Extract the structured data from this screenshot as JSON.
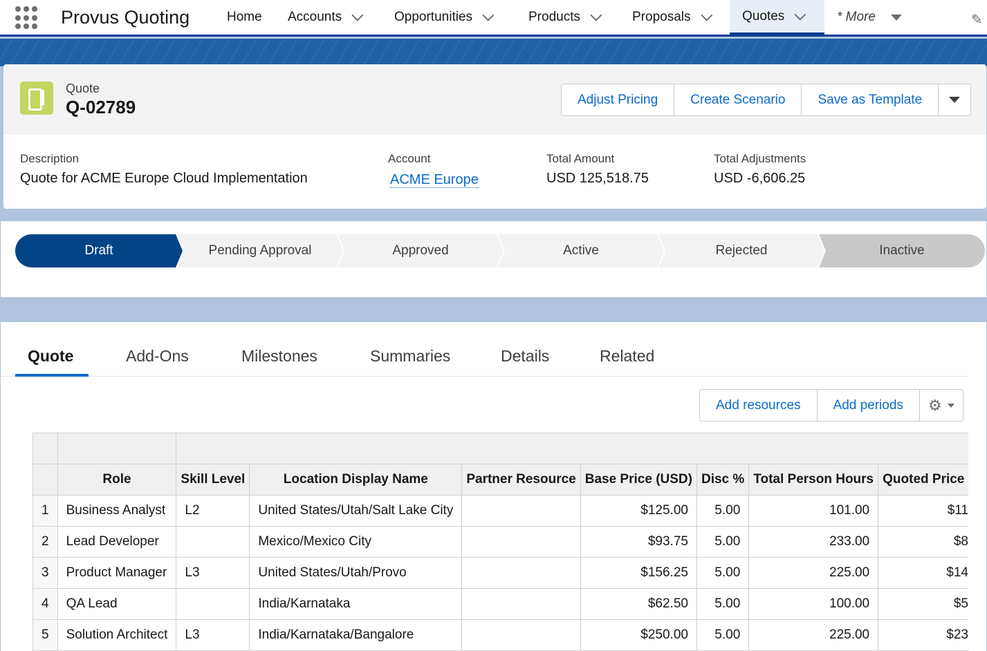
{
  "nav": {
    "app_name": "Provus Quoting",
    "items": [
      {
        "label": "Home",
        "dropdown": false
      },
      {
        "label": "Accounts",
        "dropdown": true
      },
      {
        "label": "Opportunities",
        "dropdown": true
      },
      {
        "label": "Products",
        "dropdown": true
      },
      {
        "label": "Proposals",
        "dropdown": true
      },
      {
        "label": "Quotes",
        "dropdown": true,
        "active": true
      }
    ],
    "more_label": "* More"
  },
  "header": {
    "object_label": "Quote",
    "record_name": "Q-02789",
    "actions": [
      "Adjust Pricing",
      "Create Scenario",
      "Save as Template"
    ]
  },
  "fields": [
    {
      "label": "Description",
      "value": "Quote for ACME Europe Cloud Implementation"
    },
    {
      "label": "Account",
      "value": "ACME Europe",
      "link": true
    },
    {
      "label": "Total Amount",
      "value": "USD 125,518.75"
    },
    {
      "label": "Total Adjustments",
      "value": "USD -6,606.25"
    }
  ],
  "path": {
    "stages": [
      "Draft",
      "Pending Approval",
      "Approved",
      "Active",
      "Rejected",
      "Inactive"
    ],
    "current": "Draft"
  },
  "tabs": [
    "Quote",
    "Add-Ons",
    "Milestones",
    "Summaries",
    "Details",
    "Related"
  ],
  "active_tab": "Quote",
  "grid_actions": [
    "Add resources",
    "Add periods"
  ],
  "table": {
    "columns": [
      "",
      "Role",
      "Skill Level",
      "Location Display Name",
      "Partner Resource",
      "Base Price (USD)",
      "Disc %",
      "Total Person Hours",
      "Quoted Price ("
    ],
    "rows": [
      [
        "1",
        "Business Analyst",
        "L2",
        "United States/Utah/Salt Lake City",
        "",
        "$125.00",
        "5.00",
        "101.00",
        "$11"
      ],
      [
        "2",
        "Lead Developer",
        "",
        "Mexico/Mexico City",
        "",
        "$93.75",
        "5.00",
        "233.00",
        "$8"
      ],
      [
        "3",
        "Product Manager",
        "L3",
        "United States/Utah/Provo",
        "",
        "$156.25",
        "5.00",
        "225.00",
        "$14"
      ],
      [
        "4",
        "QA Lead",
        "",
        "India/Karnataka",
        "",
        "$62.50",
        "5.00",
        "100.00",
        "$5"
      ],
      [
        "5",
        "Solution Architect",
        "L3",
        "India/Karnataka/Bangalore",
        "",
        "$250.00",
        "5.00",
        "225.00",
        "$23"
      ]
    ]
  },
  "colors": {
    "brand": "#0b3d91",
    "accent": "#0b6bcb",
    "quote_icon": "#c2d662",
    "draft_stage": "#014486"
  }
}
